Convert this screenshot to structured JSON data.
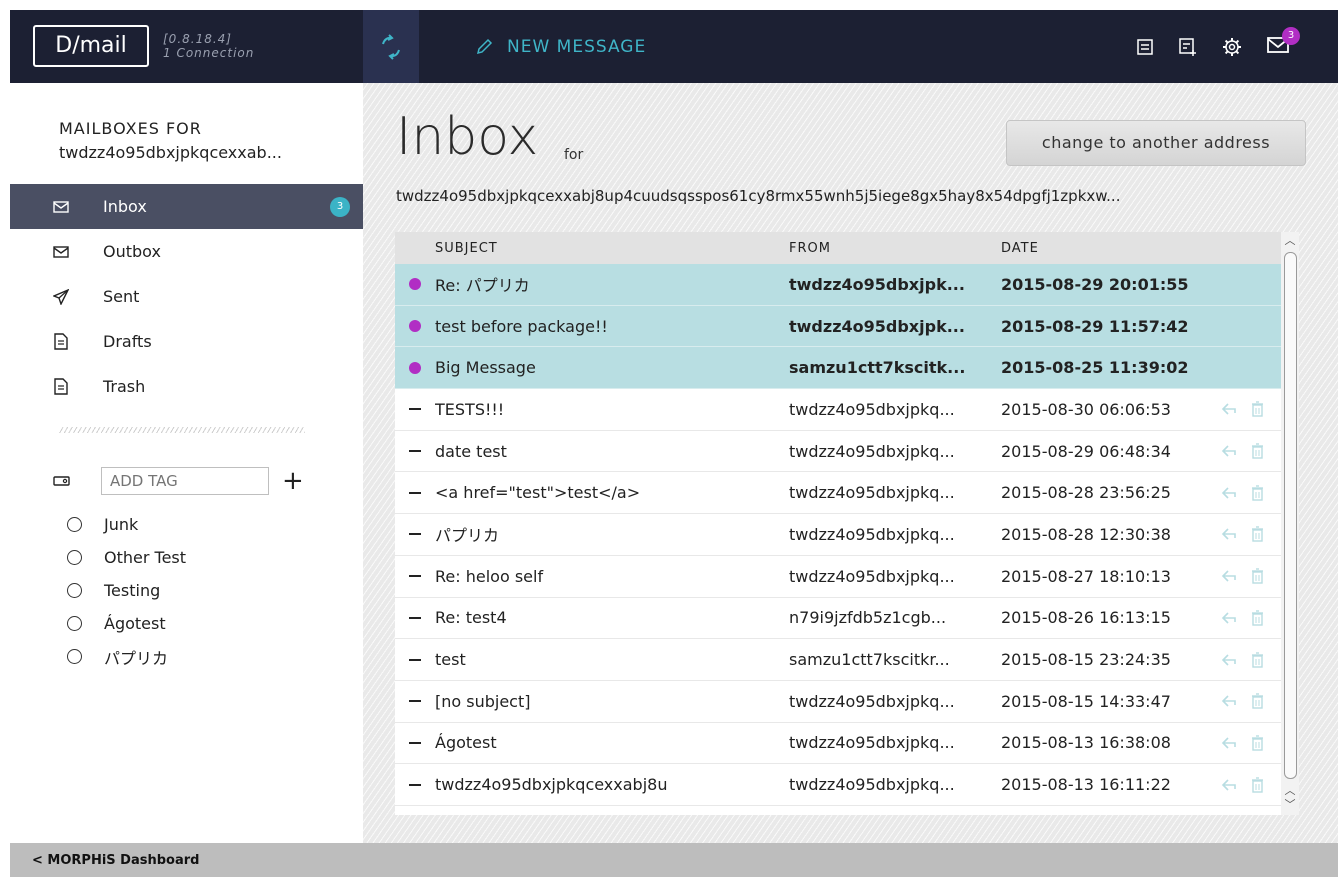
{
  "app": {
    "logo": "D/mail",
    "version": "[0.8.18.4]",
    "connection": "1 Connection",
    "new_message": "NEW MESSAGE",
    "mail_badge": "3"
  },
  "sidebar": {
    "title": "MAILBOXES FOR",
    "address": "twdzz4o95dbxjpkqcexxab...",
    "items": [
      {
        "label": "Inbox",
        "icon": "envelope-icon",
        "badge": "3"
      },
      {
        "label": "Outbox",
        "icon": "envelope-icon"
      },
      {
        "label": "Sent",
        "icon": "paper-plane-icon"
      },
      {
        "label": "Drafts",
        "icon": "document-icon"
      },
      {
        "label": "Trash",
        "icon": "document-icon"
      }
    ],
    "tag_placeholder": "ADD TAG",
    "tag_add": "+",
    "tags": [
      "Junk",
      "Other Test",
      "Testing",
      "Ágotest",
      "パプリカ"
    ]
  },
  "main": {
    "title": "Inbox",
    "for_label": "for",
    "address": "twdzz4o95dbxjpkqcexxabj8up4cuudsqsspos61cy8rmx55wnh5j5iege8gx5hay8x54dpgfj1zpkxw...",
    "change_button": "change to another address",
    "columns": {
      "subject": "SUBJECT",
      "from": "FROM",
      "date": "DATE"
    },
    "rows": [
      {
        "subject": "Re: パプリカ",
        "from": "twdzz4o95dbxjpk...",
        "date": "2015-08-29 20:01:55",
        "unread": true
      },
      {
        "subject": "test before package!!",
        "from": "twdzz4o95dbxjpk...",
        "date": "2015-08-29 11:57:42",
        "unread": true
      },
      {
        "subject": "Big Message",
        "from": "samzu1ctt7kscitk...",
        "date": "2015-08-25 11:39:02",
        "unread": true
      },
      {
        "subject": "TESTS!!!",
        "from": "twdzz4o95dbxjpkq...",
        "date": "2015-08-30 06:06:53",
        "unread": false
      },
      {
        "subject": "date test",
        "from": "twdzz4o95dbxjpkq...",
        "date": "2015-08-29 06:48:34",
        "unread": false
      },
      {
        "subject": "<a href=\"test\">test</a>",
        "from": "twdzz4o95dbxjpkq...",
        "date": "2015-08-28 23:56:25",
        "unread": false
      },
      {
        "subject": "パプリカ",
        "from": "twdzz4o95dbxjpkq...",
        "date": "2015-08-28 12:30:38",
        "unread": false
      },
      {
        "subject": "Re: heloo self",
        "from": "twdzz4o95dbxjpkq...",
        "date": "2015-08-27 18:10:13",
        "unread": false
      },
      {
        "subject": "Re: test4",
        "from": "n79i9jzfdb5z1cgb...",
        "date": "2015-08-26 16:13:15",
        "unread": false
      },
      {
        "subject": "test",
        "from": "samzu1ctt7kscitkr...",
        "date": "2015-08-15 23:24:35",
        "unread": false
      },
      {
        "subject": "[no subject]",
        "from": "twdzz4o95dbxjpkq...",
        "date": "2015-08-15 14:33:47",
        "unread": false
      },
      {
        "subject": "Ágotest",
        "from": "twdzz4o95dbxjpkq...",
        "date": "2015-08-13 16:38:08",
        "unread": false
      },
      {
        "subject": "twdzz4o95dbxjpkqcexxabj8u",
        "from": "twdzz4o95dbxjpkq...",
        "date": "2015-08-13 16:11:22",
        "unread": false
      }
    ]
  },
  "footer": {
    "label": "< MORPHiS Dashboard"
  },
  "colors": {
    "accent": "#3fb5c8",
    "unread_dot": "#b12ec4",
    "topbar": "#1c2033",
    "unread_row": "#b8dee2"
  }
}
